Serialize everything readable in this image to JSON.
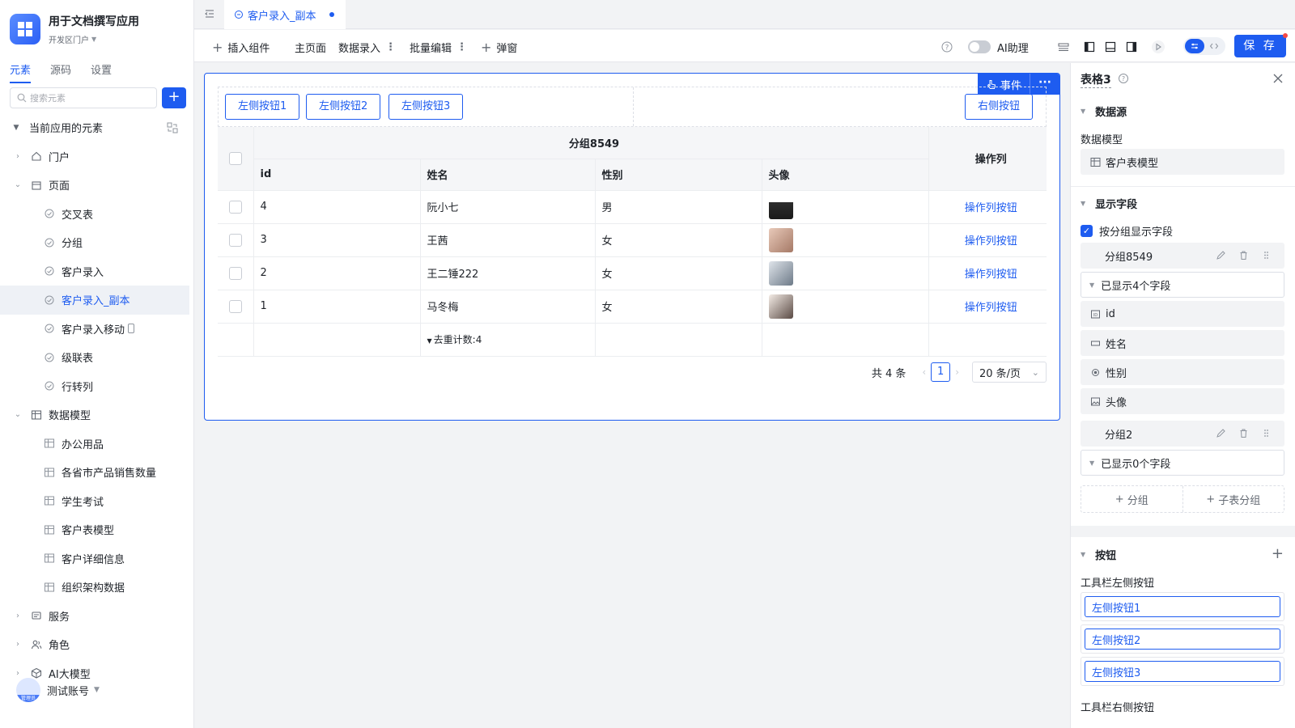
{
  "app": {
    "title": "用于文档撰写应用",
    "subtitle": "开发区门户"
  },
  "sidebar": {
    "tabs": [
      "元素",
      "源码",
      "设置"
    ],
    "search_placeholder": "搜索元素",
    "current_label": "当前应用的元素",
    "sections": {
      "portal": "门户",
      "pages": "页面",
      "models": "数据模型",
      "services": "服务",
      "roles": "角色",
      "ai": "AI大模型"
    },
    "pages": [
      "交叉表",
      "分组",
      "客户录入",
      "客户录入_副本",
      "客户录入移动",
      "级联表",
      "行转列"
    ],
    "models": [
      "办公用品",
      "各省市产品销售数量",
      "学生考试",
      "客户表模型",
      "客户详细信息",
      "组织架构数据"
    ],
    "user": {
      "name": "测试账号",
      "badge": "管理员"
    }
  },
  "tab": {
    "title": "客户录入_副本"
  },
  "toolbar": {
    "insert": "插入组件",
    "home": "主页面",
    "data_entry": "数据录入",
    "batch_edit": "批量编辑",
    "popup": "弹窗",
    "ai_assistant": "AI助理",
    "save": "保 存"
  },
  "canvas": {
    "event_btn": "事件",
    "left_buttons": [
      "左侧按钮1",
      "左侧按钮2",
      "左侧按钮3"
    ],
    "right_button": "右侧按钮",
    "table": {
      "group_header": "分组8549",
      "op_header": "操作列",
      "columns": [
        "id",
        "姓名",
        "性别",
        "头像"
      ],
      "rows": [
        {
          "id": "4",
          "name": "阮小七",
          "gender": "男",
          "op": "操作列按钮"
        },
        {
          "id": "3",
          "name": "王茜",
          "gender": "女",
          "op": "操作列按钮"
        },
        {
          "id": "2",
          "name": "王二锤222",
          "gender": "女",
          "op": "操作列按钮"
        },
        {
          "id": "1",
          "name": "马冬梅",
          "gender": "女",
          "op": "操作列按钮"
        }
      ],
      "stat": "去重计数:4"
    },
    "pager": {
      "total": "共 4 条",
      "page": "1",
      "size": "20 条/页"
    }
  },
  "panel": {
    "title": "表格3",
    "datasource": "数据源",
    "model_label": "数据模型",
    "model_value": "客户表模型",
    "display_fields": "显示字段",
    "group_check": "按分组显示字段",
    "group1": "分组8549",
    "group1_shown": "已显示4个字段",
    "fields": [
      "id",
      "姓名",
      "性别",
      "头像"
    ],
    "group2": "分组2",
    "group2_shown": "已显示0个字段",
    "add_group": "分组",
    "add_subgroup": "子表分组",
    "buttons": "按钮",
    "left_btn_label": "工具栏左侧按钮",
    "left_btns": [
      "左侧按钮1",
      "左侧按钮2",
      "左侧按钮3"
    ],
    "right_btn_label": "工具栏右侧按钮"
  },
  "colors": {
    "accent": "#1e5cf0"
  }
}
